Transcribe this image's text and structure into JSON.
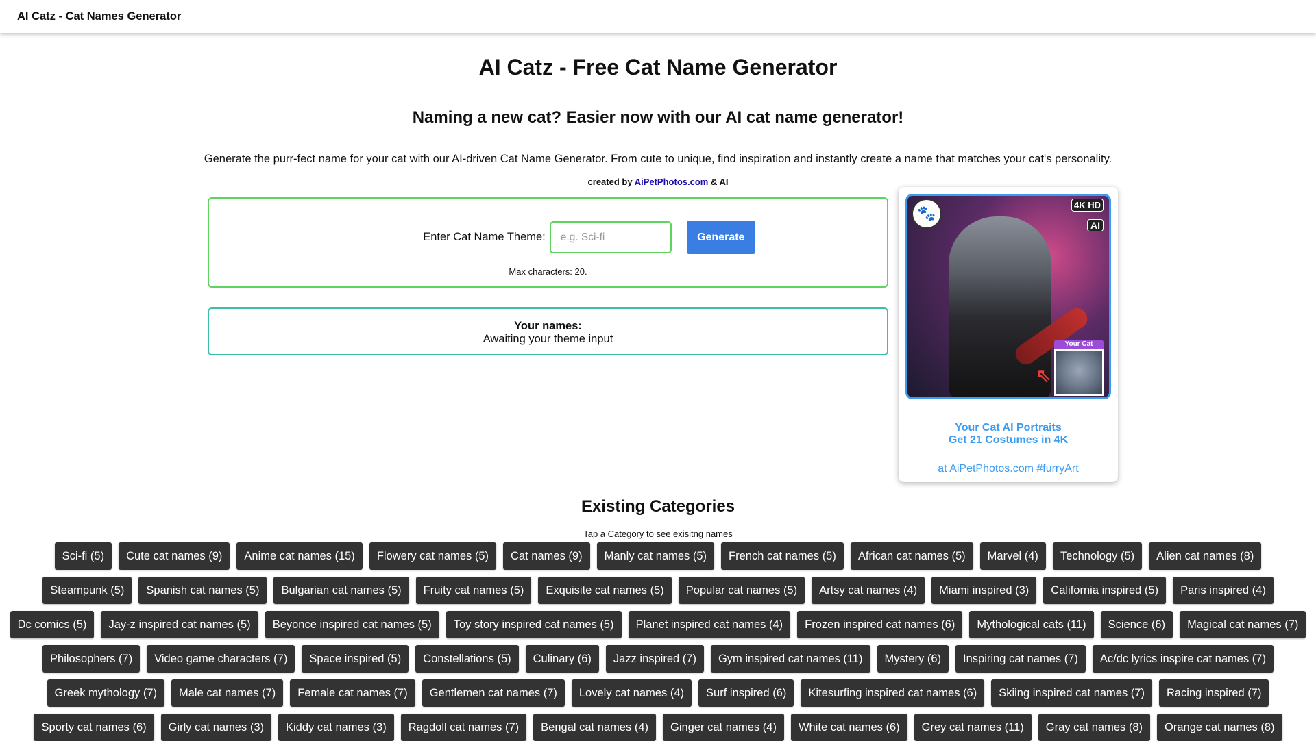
{
  "header": {
    "title": "AI Catz - Cat Names Generator"
  },
  "main": {
    "title": "AI Catz - Free Cat Name Generator",
    "subtitle": "Naming a new cat? Easier now with our AI cat name generator!",
    "intro": "Generate the purr-fect name for your cat with our AI-driven Cat Name Generator. From cute to unique, find inspiration and instantly create a name that matches your cat's personality.",
    "credits": {
      "prefix": "created by ",
      "link": "AiPetPhotos.com",
      "suffix": " & AI"
    }
  },
  "generator": {
    "label": "Enter Cat Name Theme:",
    "placeholder": "e.g. Sci-fi",
    "value": "",
    "button": "Generate",
    "max_chars": "Max characters: 20."
  },
  "results": {
    "title": "Your names:",
    "status": "Awaiting your theme input"
  },
  "promo": {
    "badge_4k": "4K HD",
    "badge_ai": "AI",
    "your_cat": "Your Cat",
    "line1": "Your Cat AI Portraits",
    "line2": "Get 21 Costumes in 4K",
    "link": "at AiPetPhotos.com #furryArt",
    "colors": {
      "accent": "#3a9bf0",
      "label_bg": "#9b4dd8"
    }
  },
  "categories": {
    "heading": "Existing Categories",
    "hint": "Tap a Category to see exisitng names",
    "items": [
      "Sci-fi (5)",
      "Cute cat names (9)",
      "Anime cat names (15)",
      "Flowery cat names (5)",
      "Cat names (9)",
      "Manly cat names (5)",
      "French cat names (5)",
      "African cat names (5)",
      "Marvel (4)",
      "Technology (5)",
      "Alien cat names (8)",
      "Steampunk (5)",
      "Spanish cat names (5)",
      "Bulgarian cat names (5)",
      "Fruity cat names (5)",
      "Exquisite cat names (5)",
      "Popular cat names (5)",
      "Artsy cat names (4)",
      "Miami inspired (3)",
      "California inspired (5)",
      "Paris inspired (4)",
      "Dc comics (5)",
      "Jay-z inspired cat names (5)",
      "Beyonce inspired cat names (5)",
      "Toy story inspired cat names (5)",
      "Planet inspired cat names (4)",
      "Frozen inspired cat names (6)",
      "Mythological cats (11)",
      "Science (6)",
      "Magical cat names (7)",
      "Philosophers (7)",
      "Video game characters (7)",
      "Space inspired (5)",
      "Constellations (5)",
      "Culinary (6)",
      "Jazz inspired (7)",
      "Gym inspired cat names (11)",
      "Mystery (6)",
      "Inspiring cat names (7)",
      "Ac/dc lyrics inspire cat names (7)",
      "Greek mythology (7)",
      "Male cat names (7)",
      "Female cat names (7)",
      "Gentlemen cat names (7)",
      "Lovely cat names (4)",
      "Surf inspired (6)",
      "Kitesurfing inspired cat names (6)",
      "Skiing inspired cat names (7)",
      "Racing inspired (7)",
      "Sporty cat names (6)",
      "Girly cat names (3)",
      "Kiddy cat names (3)",
      "Ragdoll cat names (7)",
      "Bengal cat names (4)",
      "Ginger cat names (4)",
      "White cat names (6)",
      "Grey cat names (11)",
      "Gray cat names (8)",
      "Orange cat names (8)"
    ]
  }
}
